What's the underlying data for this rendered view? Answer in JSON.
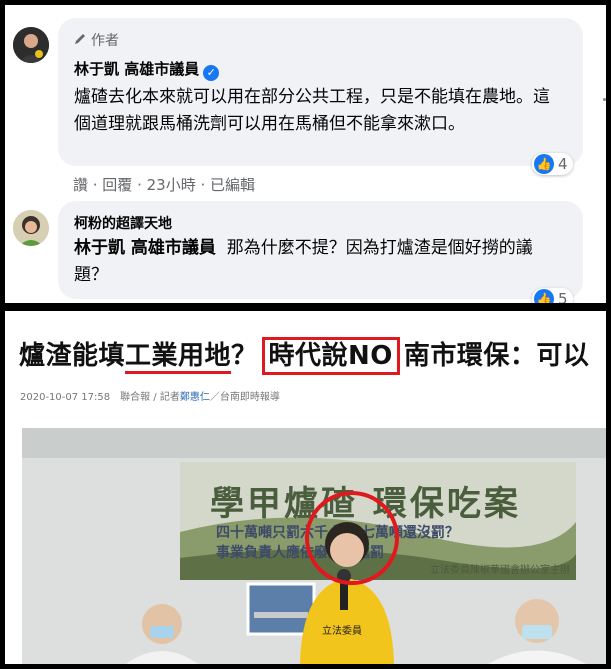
{
  "comments": [
    {
      "tag": "作者",
      "author": "林于凱 高雄市議員",
      "text": "爐碴去化本來就可以用在部分公共工程，只是不能填在農地。這個道理就跟馬桶洗劑可以用在馬桶但不能拿來漱口。",
      "meta": "讚 · 回覆 · 23小時 · 已編輯",
      "likes": "4"
    },
    {
      "author": "柯粉的超譯天地",
      "mention": "林于凱 高雄市議員",
      "text": "那為什麼不提？因為打爐渣是個好撈的議題？",
      "likes": "5"
    }
  ],
  "article": {
    "headline_pre": "爐渣能填",
    "headline_underlined": "工業用地",
    "headline_mid": "？",
    "headline_boxed": "時代說NO",
    "headline_post": "南市環保：可以",
    "byline_pre": "2020-10-07 17:58　聯合報 / 記者",
    "reporter": "鄭惠仁",
    "byline_post": "／台南即時報導",
    "banner_title": "學甲爐碴 環保吃案",
    "banner_line1": "四十萬噸只罰六千 還有七萬噸還沒罰？",
    "banner_line2": "事業負責人應依廢清法處罰",
    "banner_foot": "立法委員陳椒華國會辦公室主辦",
    "vest_text": "立法委員"
  }
}
